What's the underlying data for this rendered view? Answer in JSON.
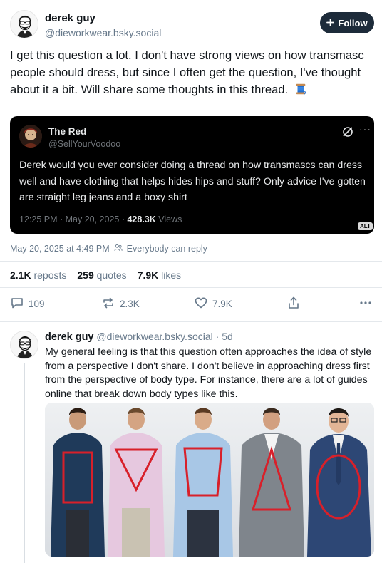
{
  "main_post": {
    "author_name": "derek guy",
    "author_handle": "@dieworkwear.bsky.social",
    "follow_label": "Follow",
    "text": "I get this question a lot. I don't have strong views on how transmasc people should dress, but since I often get the question, I've thought about it a bit. Will share some thoughts in this thread.",
    "emoji_icon": "thread-spool-icon",
    "quote": {
      "author_name": "The Red",
      "author_handle": "@SellYourVoodoo",
      "text": "Derek would you ever consider doing a thread on how transmascs can dress well and have clothing that helps hides hips and stuff? Only advice I've gotten are straight leg jeans and a boxy shirt",
      "timestamp": "12:25 PM · May 20, 2025 · ",
      "views_count": "428.3K",
      "views_label": " Views",
      "alt_badge": "ALT"
    },
    "date": "May 20, 2025 at 4:49 PM",
    "reply_setting": "Everybody can reply",
    "stats": {
      "reposts_count": "2.1K",
      "reposts_label": "reposts",
      "quotes_count": "259",
      "quotes_label": "quotes",
      "likes_count": "7.9K",
      "likes_label": "likes"
    },
    "actions": {
      "reply_count": "109",
      "repost_count": "2.3K",
      "like_count": "7.9K"
    }
  },
  "reply_post": {
    "author_name": "derek guy",
    "author_handle": "@dieworkwear.bsky.social",
    "separator": "·",
    "time_ago": "5d",
    "text": "My general feeling is that this question often approaches the idea of style from a perspective I don't share. I don't believe in approaching dress first from the perspective of body type. For instance, there are a lot of guides online that break down body types like this."
  },
  "colors": {
    "follow_bg": "#1d2b3a",
    "muted_text": "#66788a",
    "quote_bg": "#000000",
    "shape_outline": "#d8202a"
  }
}
